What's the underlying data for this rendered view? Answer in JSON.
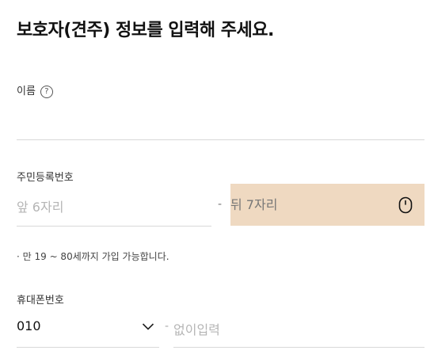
{
  "page": {
    "title": "보호자(견주) 정보를 입력해 주세요."
  },
  "name_field": {
    "label": "이름",
    "help_symbol": "?",
    "value": ""
  },
  "resident_number": {
    "label": "주민등록번호",
    "front_placeholder": "앞 6자리",
    "separator": "-",
    "back_placeholder": "뒤 7자리",
    "note": "· 만 19 ~ 80세까지 가입 가능합니다."
  },
  "phone": {
    "label": "휴대폰번호",
    "prefix_selected": "010",
    "separator": "-",
    "number_placeholder": "없이입력"
  },
  "colors": {
    "highlight_bg": "#efd9c1",
    "border": "#d9d9d9"
  }
}
